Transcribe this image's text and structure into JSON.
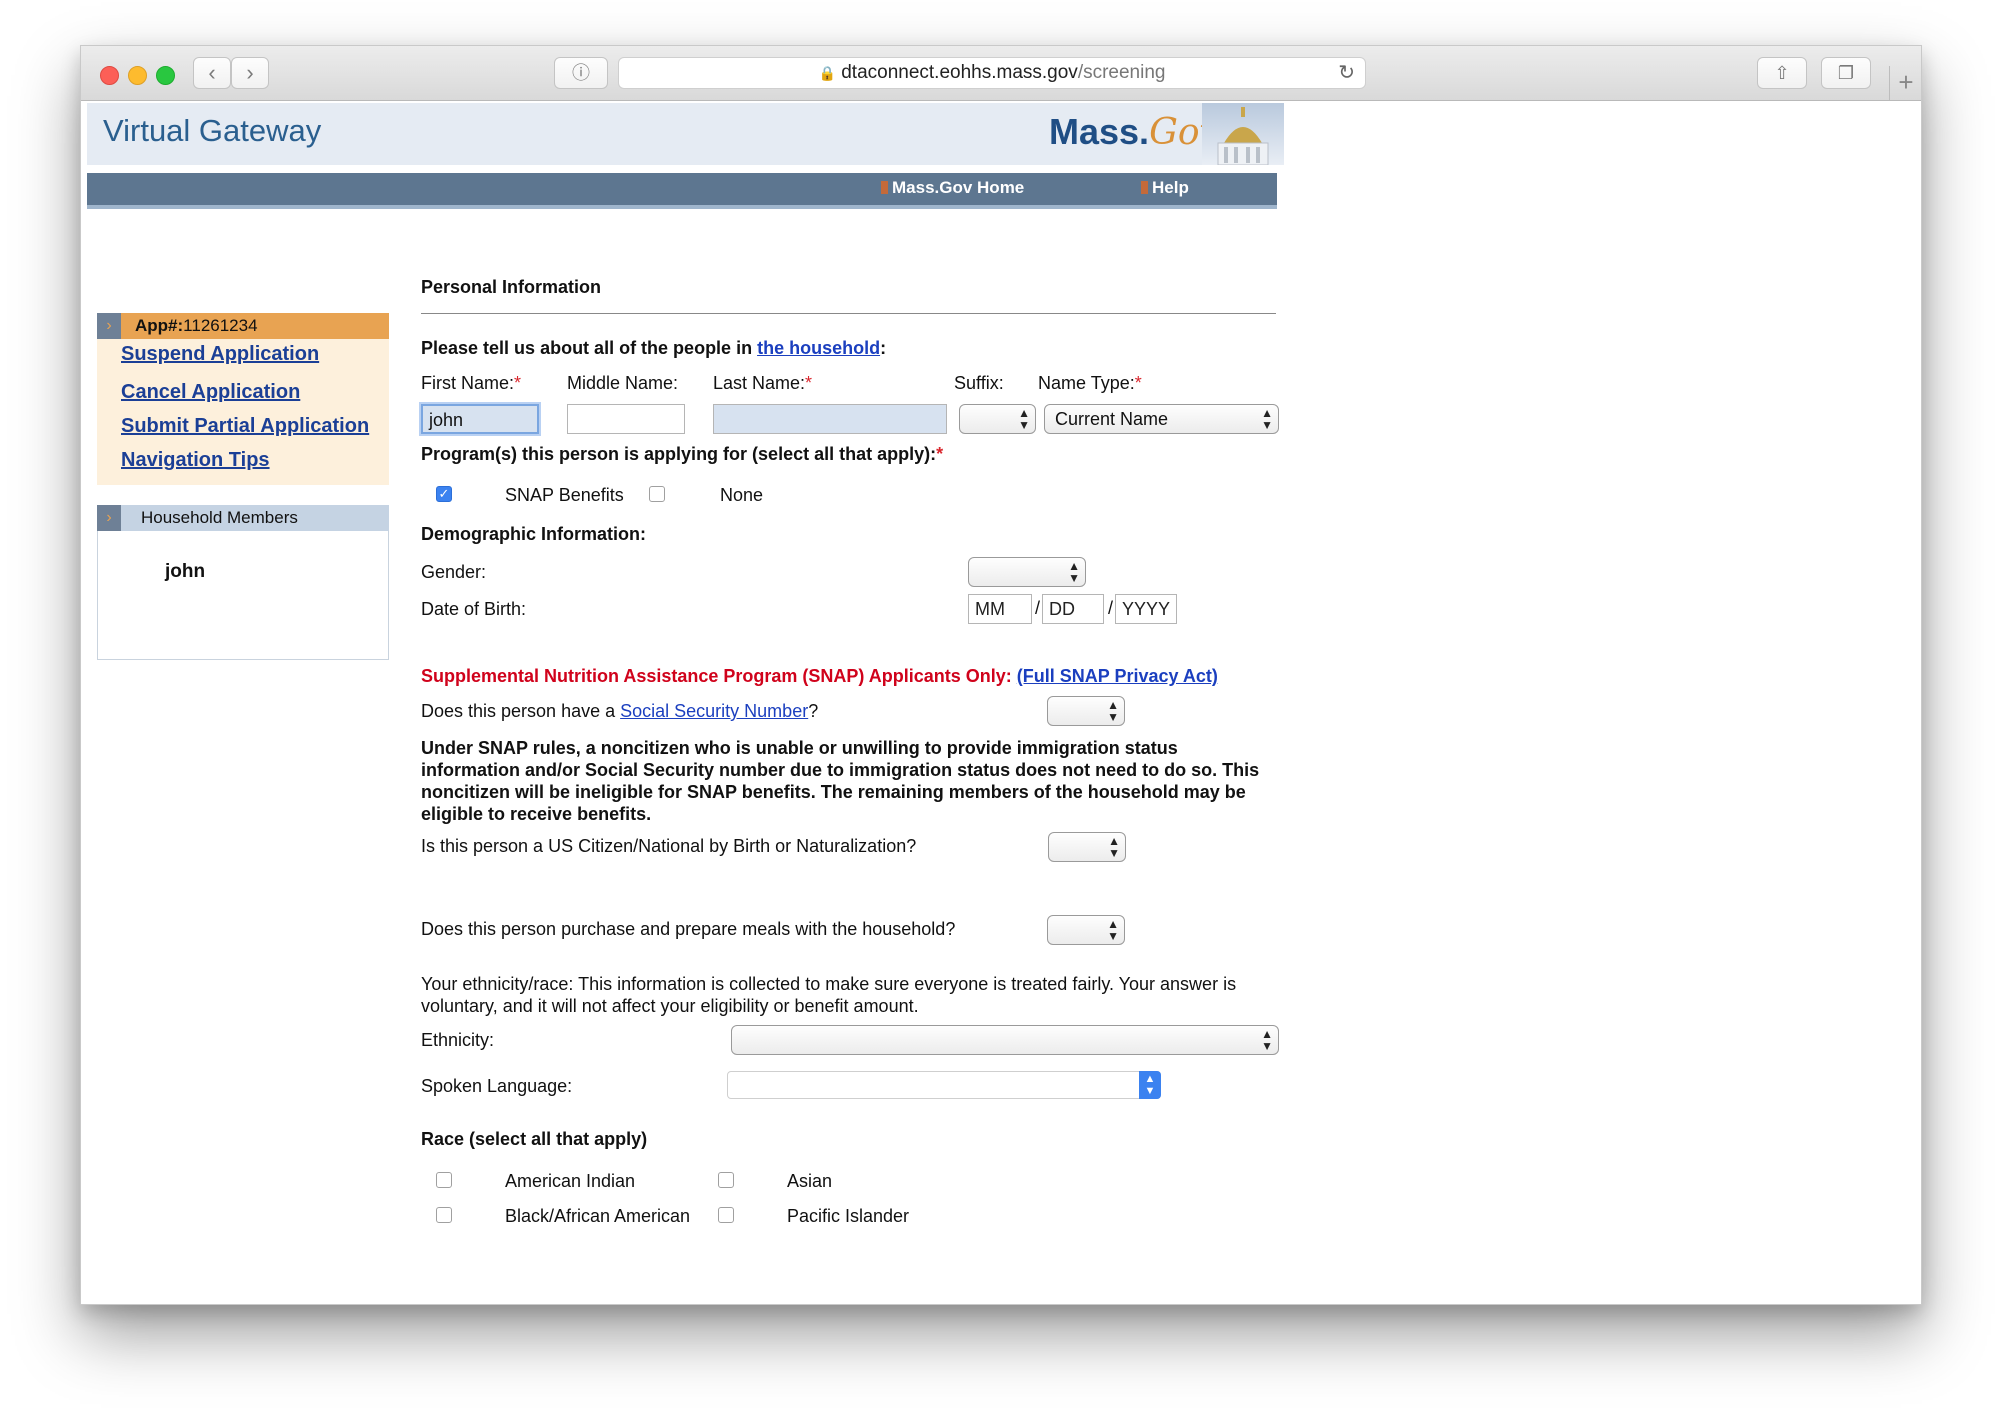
{
  "browser": {
    "url_host": "dtaconnect.eohhs.mass.gov",
    "url_path": "/screening"
  },
  "header": {
    "brand": "Virtual Gateway",
    "logo_text": "Mass.",
    "logo_script": "Gov",
    "nav": [
      "Mass.Gov Home",
      "Help"
    ]
  },
  "sidebar": {
    "app_label": "App#:",
    "app_number": "11261234",
    "links": [
      "Suspend Application",
      "Cancel Application",
      "Submit Partial Application",
      "Navigation Tips"
    ],
    "household_title": "Household Members",
    "members": [
      "john"
    ]
  },
  "form": {
    "section_title": "Personal Information",
    "intro": "Please tell us about all of the people in ",
    "intro_link": "the household",
    "intro_end": ":",
    "labels": {
      "first_name": "First Name:",
      "middle_name": "Middle Name:",
      "last_name": "Last Name:",
      "suffix": "Suffix:",
      "name_type": "Name Type:"
    },
    "required_mark": "*",
    "values": {
      "first_name": "john",
      "middle_name": "",
      "last_name": "",
      "name_type": "Current Name"
    },
    "programs_label": "Program(s) this person is applying for (select all that apply):",
    "programs": [
      {
        "label": "SNAP Benefits",
        "checked": true
      },
      {
        "label": "None",
        "checked": false
      }
    ],
    "demographic_title": "Demographic Information:",
    "gender_label": "Gender:",
    "dob_label": "Date of Birth:",
    "dob_placeholders": {
      "mm": "MM",
      "dd": "DD",
      "yyyy": "YYYY"
    },
    "dob_sep": "/",
    "snap_heading": "Supplemental Nutrition Assistance Program (SNAP) Applicants Only:",
    "snap_link": "(Full SNAP Privacy Act)",
    "ssn_q_start": "Does this person have a ",
    "ssn_link": "Social Security Number",
    "ssn_q_end": "?",
    "snap_rules": "Under SNAP rules, a noncitizen who is unable or unwilling to provide immigration status information and/or Social Security number due to immigration status does not need to do so. This noncitizen will be ineligible for SNAP benefits. The remaining members of the household may be eligible to receive benefits.",
    "citizen_q": "Is this person a US Citizen/National by Birth or Naturalization?",
    "meals_q": "Does this person purchase and prepare meals with the household?",
    "ethnicity_note": "Your ethnicity/race: This information is collected to make sure everyone is treated fairly. Your answer is voluntary, and it will not affect your eligibility or benefit amount.",
    "ethnicity_label": "Ethnicity:",
    "language_label": "Spoken Language:",
    "race_title": "Race (select all that apply)",
    "races": [
      "American Indian",
      "Asian",
      "Black/African American",
      "Pacific Islander"
    ]
  },
  "colors": {
    "brand_blue": "#2a5f8f",
    "nav_bar": "#5d7690",
    "app_orange": "#e8a352",
    "link_blue": "#1b3fbf",
    "snap_red": "#d0021b",
    "required_red": "#d9262d",
    "checkbox_blue": "#3b82f0"
  },
  "icons": [
    "close-light",
    "minimize-light",
    "zoom-light",
    "back-icon",
    "forward-icon",
    "reader-icon",
    "lock-icon",
    "reload-icon",
    "share-icon",
    "tabs-icon",
    "new-tab-icon",
    "chevron-right-icon"
  ]
}
